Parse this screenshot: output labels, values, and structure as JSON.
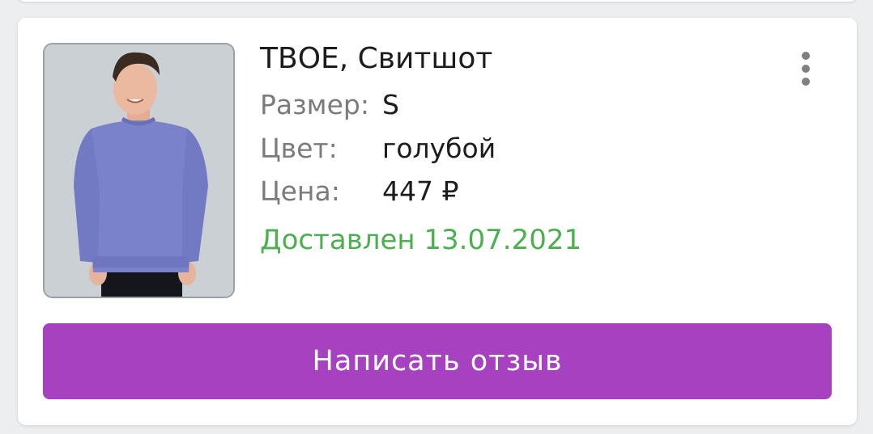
{
  "product": {
    "title": "ТВОЕ, Свитшот",
    "image_icon": "product-photo-sweatshirt",
    "size_label": "Размер:",
    "size_value": "S",
    "color_label": "Цвет:",
    "color_value": "голубой",
    "price_label": "Цена:",
    "price_value": "447 ₽",
    "status": "Доставлен 13.07.2021"
  },
  "actions": {
    "more_icon": "more-vertical-icon",
    "review_label": "Написать отзыв"
  },
  "colors": {
    "accent": "#a642bf",
    "status_delivered": "#4caf50",
    "sweatshirt": "#7b82cc"
  }
}
